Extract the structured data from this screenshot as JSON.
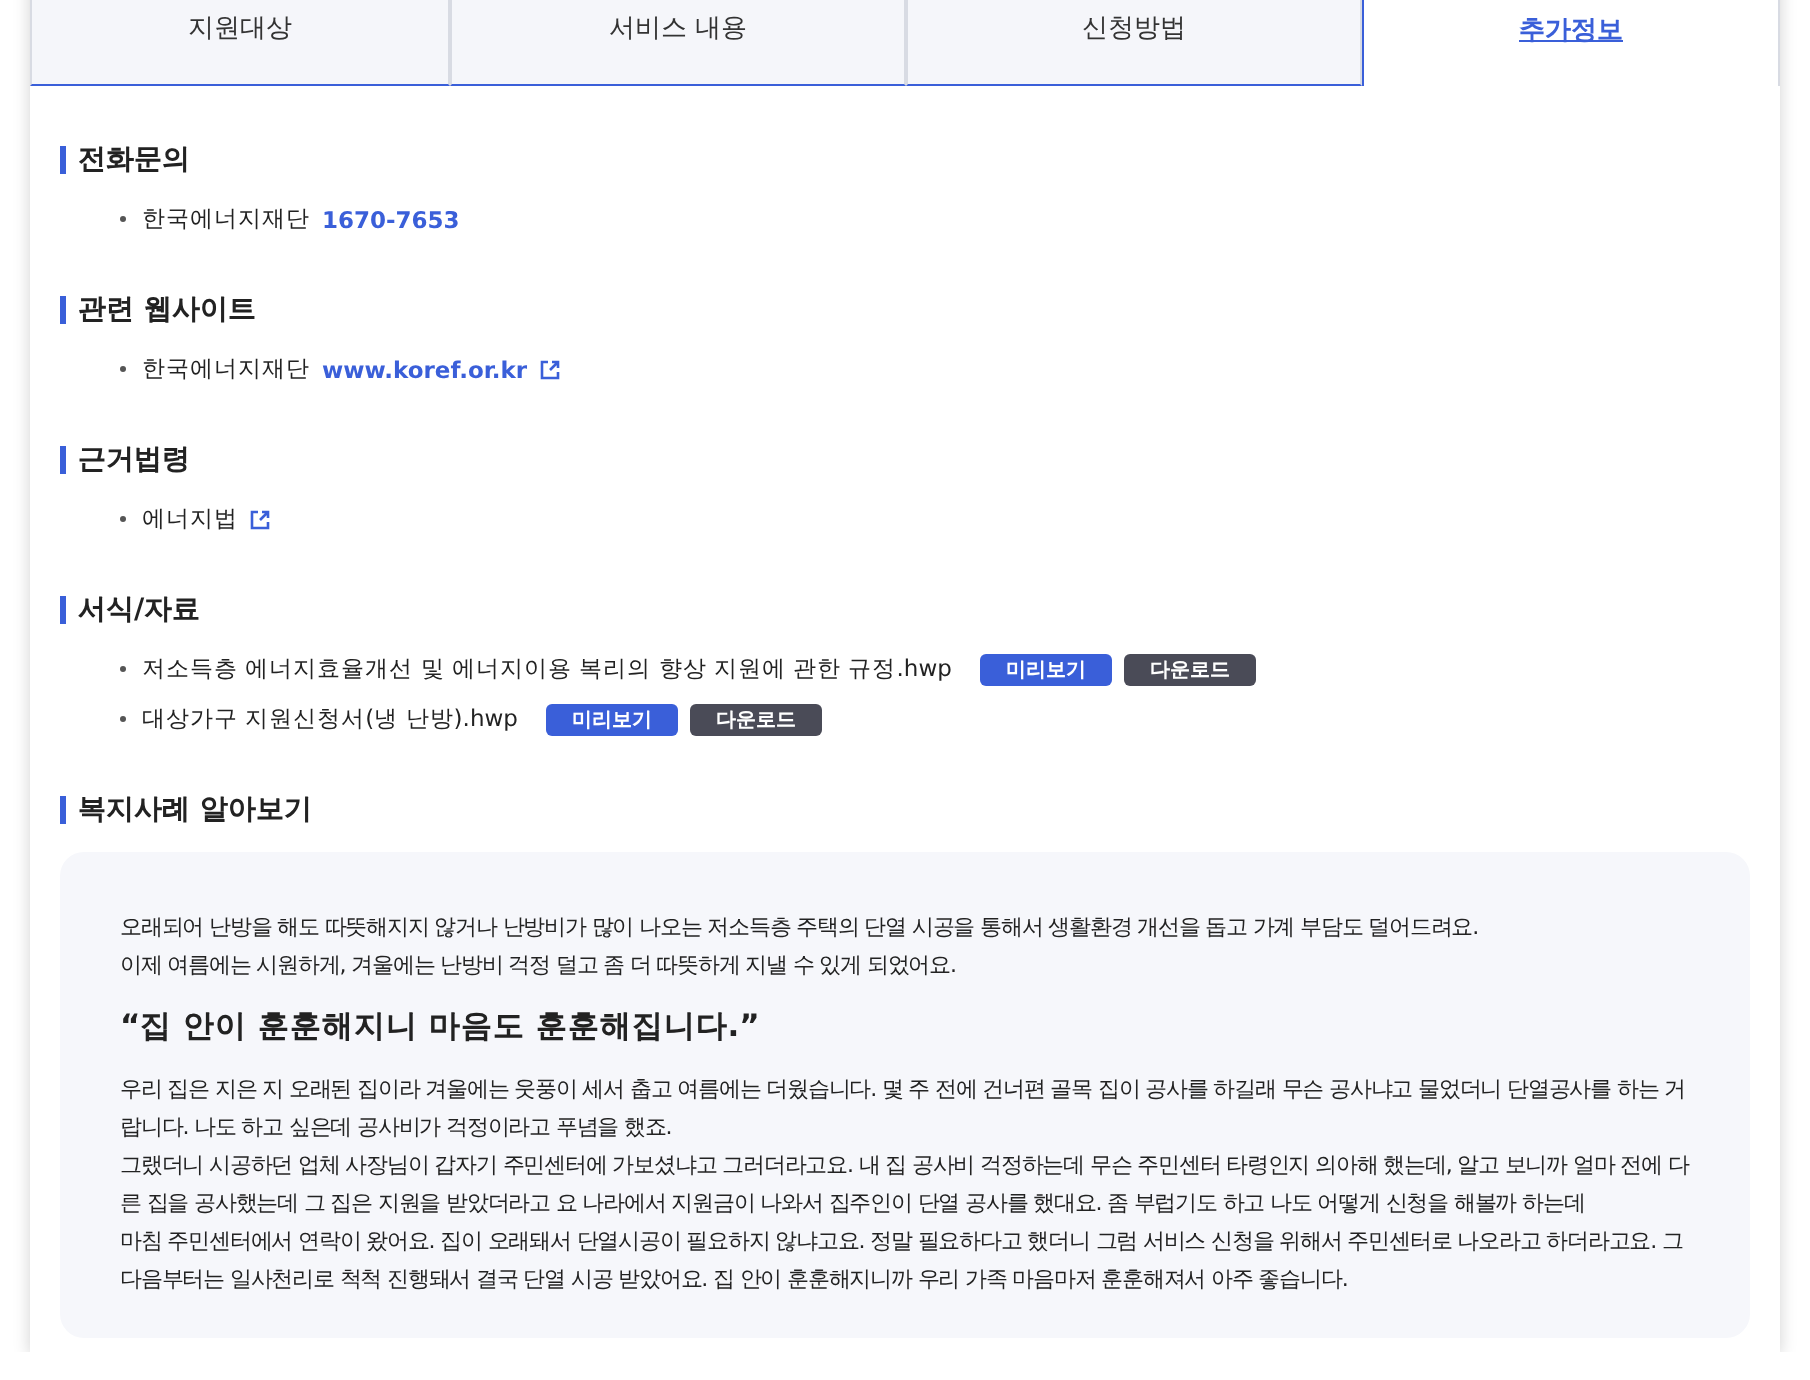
{
  "tabs": [
    {
      "label": "지원대상",
      "selected": false
    },
    {
      "label": "서비스 내용",
      "selected": false
    },
    {
      "label": "신청방법",
      "selected": false
    },
    {
      "label": "추가정보",
      "selected": true
    }
  ],
  "sections": [
    {
      "title": "전화문의",
      "items": [
        {
          "kind": "phone",
          "text": "한국에너지재단",
          "link": "1670-7653"
        }
      ]
    },
    {
      "title": "관련 웹사이트",
      "items": [
        {
          "kind": "site",
          "text": "한국에너지재단",
          "link": "www.koref.or.kr"
        }
      ]
    },
    {
      "title": "근거법령",
      "items": [
        {
          "kind": "law",
          "text": "에너지법"
        }
      ]
    },
    {
      "title": "서식/자료",
      "items": [
        {
          "kind": "file",
          "text": "저소득층 에너지효율개선 및 에너지이용 복리의 향상 지원에 관한 규정.hwp",
          "preview": "미리보기",
          "download": "다운로드"
        },
        {
          "kind": "file",
          "text": "대상가구 지원신청서(냉 난방).hwp",
          "preview": "미리보기",
          "download": "다운로드"
        }
      ]
    }
  ],
  "case": {
    "title": "복지사례 알아보기",
    "intro": [
      "오래되어 난방을 해도 따뜻해지지 않거나 난방비가 많이 나오는 저소득층 주택의 단열 시공을 통해서 생활환경 개선을 돕고 가계 부담도 덜어드려요.",
      "이제 여름에는 시원하게, 겨울에는 난방비 걱정 덜고 좀 더 따뜻하게 지낼 수 있게 되었어요."
    ],
    "quote": "“집 안이 훈훈해지니 마음도 훈훈해집니다.”",
    "story": [
      "우리 집은 지은 지 오래된 집이라 겨울에는 웃풍이 세서 춥고 여름에는 더웠습니다. 몇 주 전에 건너편 골목 집이 공사를 하길래 무슨 공사냐고 물었더니 단열공사를 하는 거",
      "랍니다. 나도 하고 싶은데 공사비가 걱정이라고 푸념을 했죠.",
      "그랬더니 시공하던 업체 사장님이 갑자기 주민센터에 가보셨냐고 그러더라고요. 내 집 공사비 걱정하는데 무슨 주민센터 타령인지 의아해 했는데, 알고 보니까 얼마 전에 다",
      "른 집을 공사했는데 그 집은 지원을 받았더라고 요 나라에서 지원금이 나와서 집주인이 단열 공사를 했대요. 좀 부럽기도 하고 나도 어떻게 신청을 해볼까 하는데",
      "마침 주민센터에서 연락이 왔어요. 집이 오래돼서 단열시공이 필요하지 않냐고요. 정말 필요하다고 했더니 그럼 서비스 신청을 위해서 주민센터로 나오라고 하더라고요. 그",
      "다음부터는 일사천리로 척척 진행돼서 결국 단열 시공 받았어요. 집 안이 훈훈해지니까 우리 가족 마음마저 훈훈해져서 아주 좋습니다."
    ]
  }
}
